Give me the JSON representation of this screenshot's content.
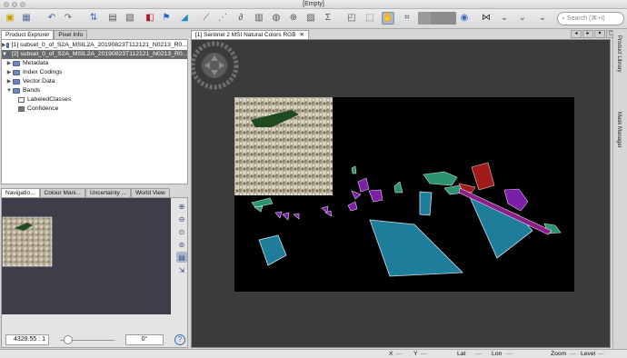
{
  "window": {
    "title": "[Empty]"
  },
  "toolbar": {
    "search_placeholder": "Search (⌘+I)"
  },
  "product_explorer": {
    "tabs": [
      "Product Explorer",
      "Pixel Info"
    ],
    "products": [
      "[1] subset_0_of_S2A_MSIL2A_20190823T112121_N0213_R0...",
      "[2] subset_0_of_S2A_MSIL2A_20190823T112121_N0213_R0..."
    ],
    "nodes": [
      "Metadata",
      "Index Codings",
      "Vector Data",
      "Bands"
    ],
    "bands": [
      "LabeledClasses",
      "Confidence"
    ]
  },
  "navigation": {
    "tabs": [
      "Navigatio...",
      "Colour Mani...",
      "Uncertainty ...",
      "World View"
    ],
    "scale": "4329.55 : 1",
    "rotation": "0°"
  },
  "view": {
    "tab_label": "[1] Sentinel 2 MSI Natural Colors RGB"
  },
  "right_sidebar": {
    "items": [
      "Product Library",
      "Mask Manager"
    ]
  },
  "statusbar": {
    "x": "X",
    "y": "Y",
    "lat": "Lat",
    "lon": "Lon",
    "zoom": "Zoom",
    "level": "Level"
  },
  "icons": [
    "open-product-icon",
    "save-icon",
    "undo-icon",
    "redo-icon",
    "band-maths-icon",
    "graph-builder-icon",
    "select-tool-icon",
    "pan-tool-icon",
    "zoom-tool-icon",
    "range-finder-icon",
    "search-icon",
    "help-icon"
  ],
  "colors": {
    "view_bg": "#3b3b3b",
    "selected_row": "#6b6b6b",
    "water": "#1e7d9b",
    "forest": "#2a9470",
    "vineyard": "#7a1fa6",
    "urban": "#a01a1a"
  }
}
